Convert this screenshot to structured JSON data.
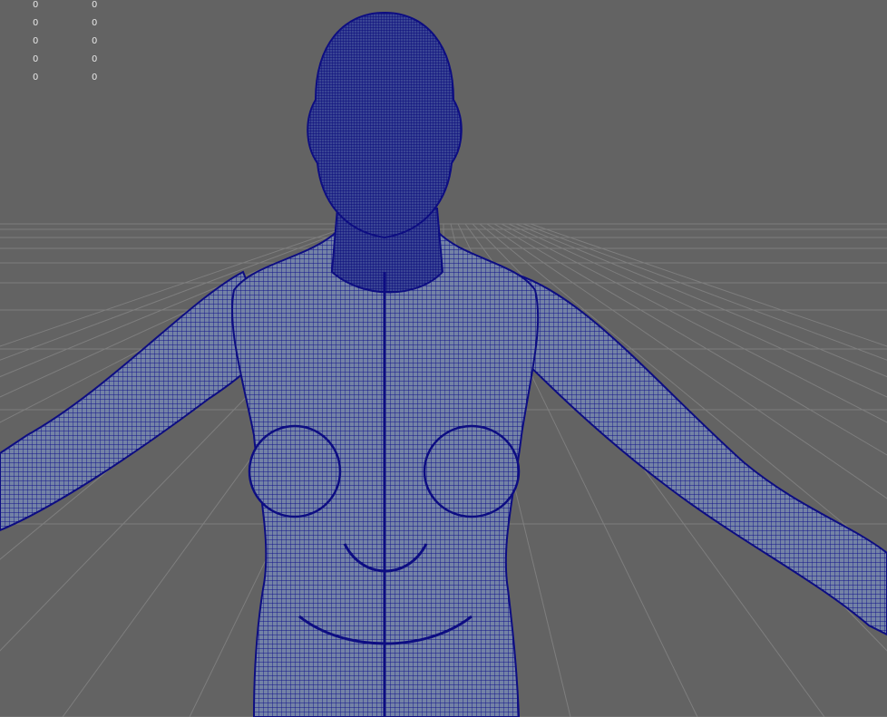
{
  "viewport": {
    "name": "perspective-viewport",
    "background_color": "#636363",
    "grid_color": "#7e7e7e",
    "wireframe_color": "#0d0d82",
    "mesh_fill_color": "#6f7fa6"
  },
  "hud": {
    "rows": [
      {
        "col1": "0",
        "col2": "0"
      },
      {
        "col1": "0",
        "col2": "0"
      },
      {
        "col1": "0",
        "col2": "0"
      },
      {
        "col1": "0",
        "col2": "0"
      },
      {
        "col1": "0",
        "col2": "0"
      }
    ]
  }
}
